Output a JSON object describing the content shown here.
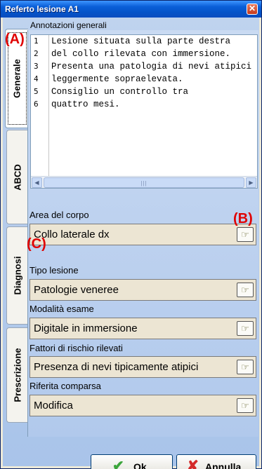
{
  "window": {
    "title": "Referto lesione A1",
    "close_glyph": "✕"
  },
  "tabs": [
    {
      "label": "Generale",
      "active": true
    },
    {
      "label": "ABCD",
      "active": false
    },
    {
      "label": "Diagnosi",
      "active": false
    },
    {
      "label": "Prescrizione",
      "active": false
    }
  ],
  "notes": {
    "title": "Annotazioni generali",
    "line_numbers": [
      "1",
      "2",
      "3",
      "4",
      "5",
      "6"
    ],
    "lines": [
      "Lesione situata sulla parte destra",
      "del collo rilevata con immersione.",
      "Presenta una patologia di nevi atipici",
      "leggermente sopraelevata.",
      "Consiglio un controllo tra",
      "quattro mesi."
    ]
  },
  "fields": [
    {
      "label": "Area del corpo",
      "value": "Collo laterale dx"
    },
    {
      "label": "Tipo lesione",
      "value": "Patologie veneree"
    },
    {
      "label": "Modalità esame",
      "value": "Digitale in immersione"
    },
    {
      "label": "Fattori di rischio rilevati",
      "value": "Presenza di nevi tipicamente atipici"
    },
    {
      "label": "Riferita comparsa",
      "value": "Modifica"
    }
  ],
  "annotations": {
    "a": "(A)",
    "b": "(B)",
    "c": "(C)"
  },
  "buttons": {
    "ok": "Ok",
    "cancel": "Annulla"
  },
  "icons": {
    "pick": "picker-hand-icon",
    "ok": "checkmark-icon",
    "cancel": "cross-icon"
  },
  "colors": {
    "titlebar": "#0a5fd8",
    "annotation": "#e00000",
    "field_bg": "#ece5d3"
  }
}
